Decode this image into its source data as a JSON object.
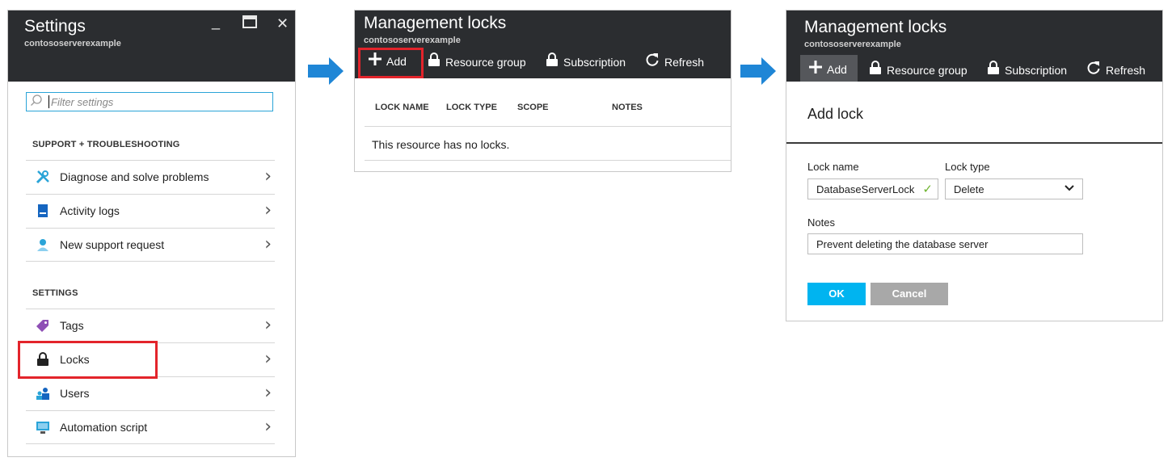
{
  "settings_blade": {
    "title": "Settings",
    "subtitle": "contososerverexample",
    "window_controls": {
      "minimize": "_",
      "maximize": "□",
      "close": "✕"
    },
    "filter_placeholder": "Filter settings",
    "sections": [
      {
        "heading": "SUPPORT + TROUBLESHOOTING",
        "items": [
          {
            "label": "Diagnose and solve problems",
            "icon": "wrench-icon",
            "icon_color": "#2aa4d8"
          },
          {
            "label": "Activity logs",
            "icon": "log-icon",
            "icon_color": "#1565c0"
          },
          {
            "label": "New support request",
            "icon": "support-person-icon",
            "icon_color": "#2aa4d8"
          }
        ]
      },
      {
        "heading": "SETTINGS",
        "items": [
          {
            "label": "Tags",
            "icon": "tag-icon",
            "icon_color": "#8e4fb5"
          },
          {
            "label": "Locks",
            "icon": "lock-icon",
            "icon_color": "#222222",
            "highlighted": true
          },
          {
            "label": "Users",
            "icon": "users-icon",
            "icon_color": "#2aa4d8"
          },
          {
            "label": "Automation script",
            "icon": "script-icon",
            "icon_color": "#2aa4d8"
          }
        ]
      }
    ]
  },
  "locks_blade": {
    "title": "Management locks",
    "subtitle": "contososerverexample",
    "toolbar": {
      "add": "Add",
      "resource_group": "Resource group",
      "subscription": "Subscription",
      "refresh": "Refresh"
    },
    "columns": [
      "LOCK NAME",
      "LOCK TYPE",
      "SCOPE",
      "NOTES"
    ],
    "empty_message": "This resource has no locks."
  },
  "add_lock_blade": {
    "title": "Management locks",
    "subtitle": "contososerverexample",
    "toolbar": {
      "add": "Add",
      "resource_group": "Resource group",
      "subscription": "Subscription",
      "refresh": "Refresh"
    },
    "heading": "Add lock",
    "lock_name_label": "Lock name",
    "lock_name_value": "DatabaseServerLock",
    "lock_type_label": "Lock type",
    "lock_type_value": "Delete",
    "notes_label": "Notes",
    "notes_value": "Prevent deleting the database server",
    "ok_label": "OK",
    "cancel_label": "Cancel"
  },
  "colors": {
    "header_bg": "#2b2d30",
    "highlight_red": "#e3242b",
    "ok_button": "#00b4f0",
    "cancel_button": "#a8a8a8",
    "arrow_blue": "#1f86d6"
  }
}
